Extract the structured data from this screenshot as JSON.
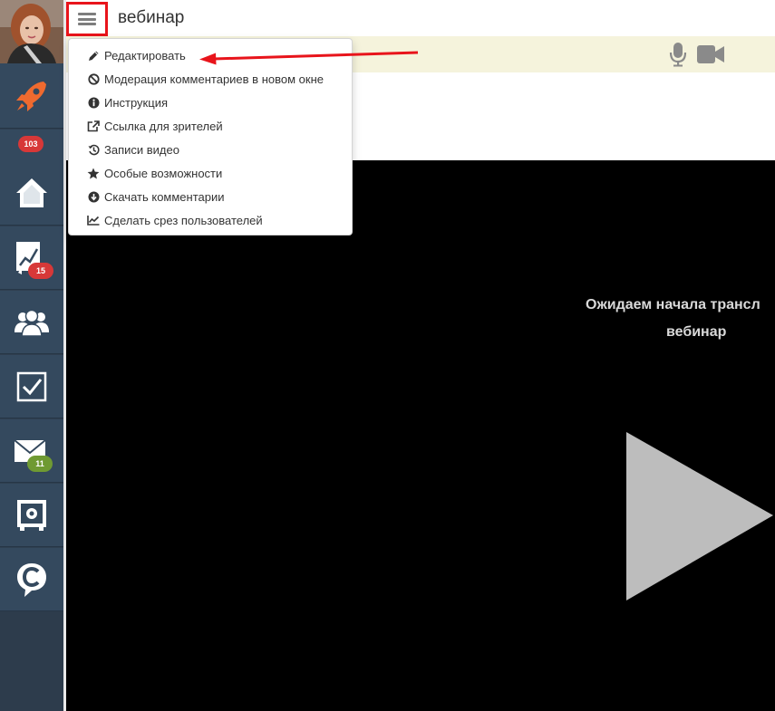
{
  "header": {
    "title": "вебинар",
    "menu_icon": "hamburger-icon"
  },
  "sidebar": {
    "items": [
      {
        "name": "rocket",
        "icon": "rocket-icon"
      },
      {
        "name": "home",
        "icon": "home-icon",
        "badge": "103"
      },
      {
        "name": "stats",
        "icon": "chart-icon",
        "badge": "15"
      },
      {
        "name": "users",
        "icon": "users-icon"
      },
      {
        "name": "tasks",
        "icon": "checkbox-icon"
      },
      {
        "name": "mail",
        "icon": "mail-icon",
        "badge": "11"
      },
      {
        "name": "safe",
        "icon": "safe-icon"
      },
      {
        "name": "chat",
        "icon": "chat-c-icon"
      }
    ]
  },
  "dropdown": {
    "items": [
      {
        "label": "Редактировать",
        "icon": "pencil-icon"
      },
      {
        "label": "Модерация комментариев в новом окне",
        "icon": "ban-icon"
      },
      {
        "label": "Инструкция",
        "icon": "info-icon"
      },
      {
        "label": "Ссылка для зрителей",
        "icon": "external-link-icon"
      },
      {
        "label": "Записи видео",
        "icon": "history-icon"
      },
      {
        "label": "Особые возможности",
        "icon": "star-icon"
      },
      {
        "label": "Скачать комментарии",
        "icon": "download-icon"
      },
      {
        "label": "Сделать срез пользователей",
        "icon": "line-chart-icon"
      }
    ]
  },
  "toolbar": {
    "mic_icon": "microphone-icon",
    "camera_icon": "video-camera-icon"
  },
  "video": {
    "waiting_line1": "Ожидаем начала трансл",
    "waiting_line2": "вебинар"
  },
  "colors": {
    "sidebar": "#34495e",
    "badge_red": "#d73838",
    "badge_green": "#6f9a32",
    "highlight": "#e8141b",
    "toolbar_bg": "#f5f3dc"
  }
}
